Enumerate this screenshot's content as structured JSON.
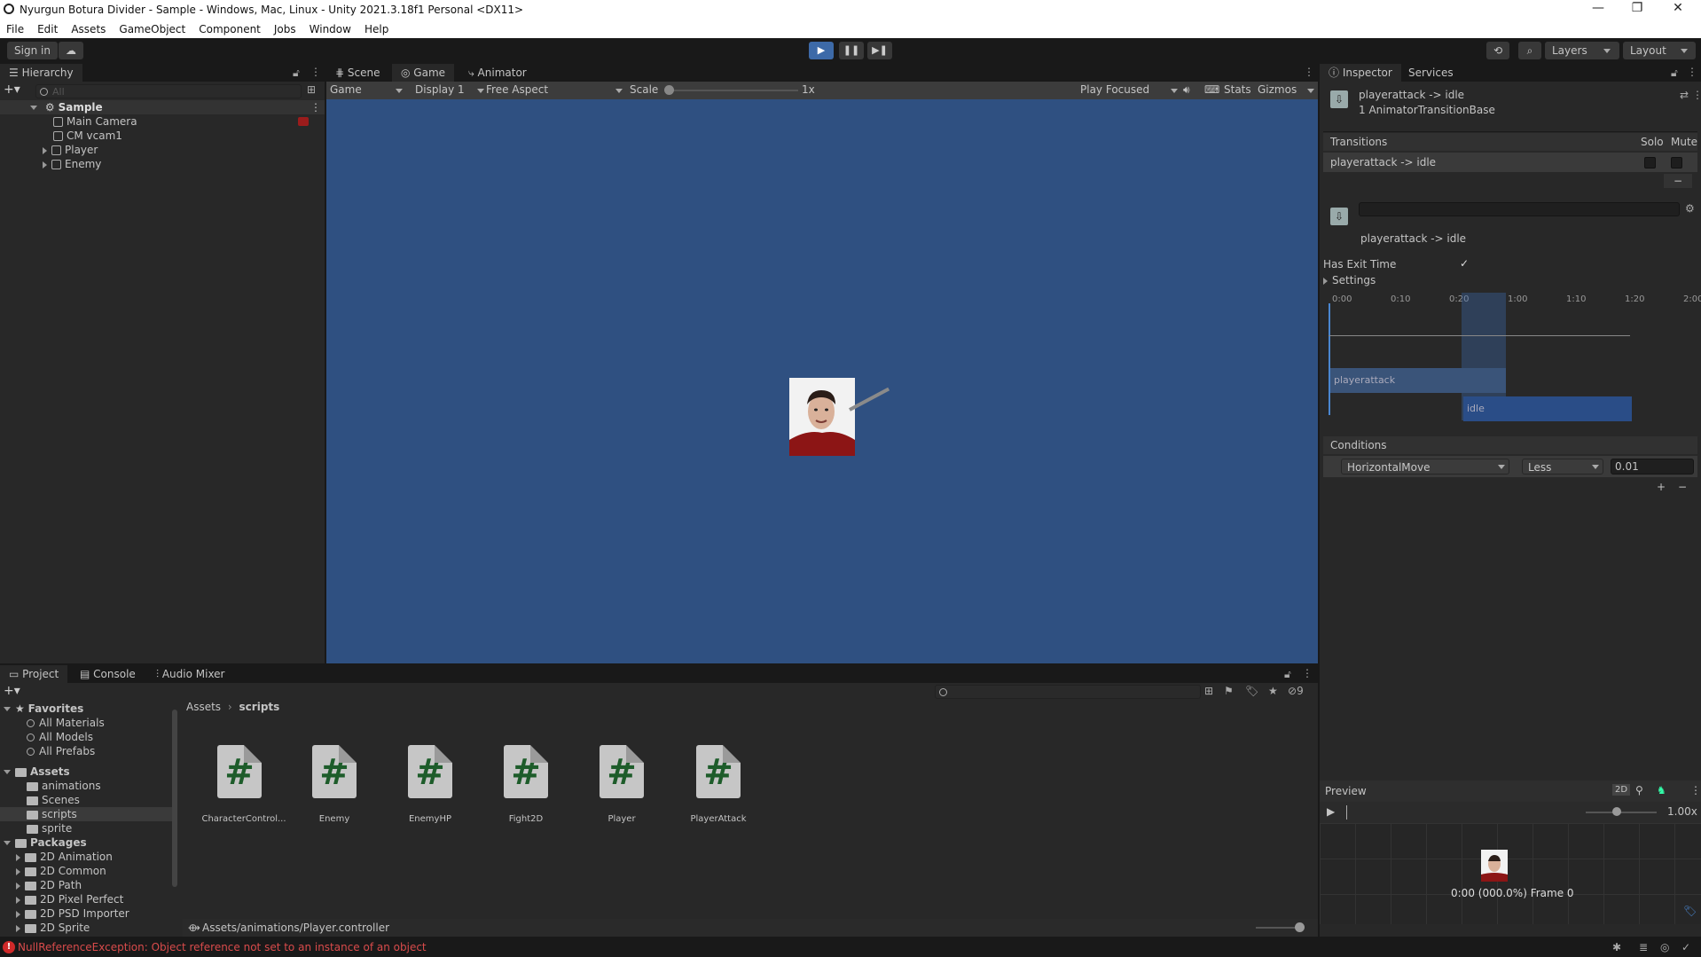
{
  "window": {
    "title": "Nyurgun Botura Divider - Sample - Windows, Mac, Linux - Unity 2021.3.18f1 Personal <DX11>",
    "controls": [
      "—",
      "❐",
      "✕"
    ]
  },
  "menu": [
    "File",
    "Edit",
    "Assets",
    "GameObject",
    "Component",
    "Jobs",
    "Window",
    "Help"
  ],
  "toolbar": {
    "sign_in": "Sign in",
    "layers": "Layers",
    "layout": "Layout"
  },
  "hierarchy": {
    "tab": "Hierarchy",
    "search_placeholder": "All",
    "scene": "Sample",
    "items": [
      "Main Camera",
      "CM vcam1",
      "Player",
      "Enemy"
    ]
  },
  "view_tabs": [
    "Scene",
    "Game",
    "Animator"
  ],
  "game_bar": {
    "mode": "Game",
    "display": "Display 1",
    "aspect": "Free Aspect",
    "scale_label": "Scale",
    "scale_value": "1x",
    "play_mode": "Play Focused",
    "stats": "Stats",
    "gizmos": "Gizmos",
    "background": "#2f5081"
  },
  "inspector": {
    "tabs": [
      "Inspector",
      "Services"
    ],
    "header_title": "playerattack -> idle",
    "header_subtitle": "1 AnimatorTransitionBase",
    "transitions_label": "Transitions",
    "solo": "Solo",
    "mute": "Mute",
    "transition_item": "playerattack -> idle",
    "minus": "−",
    "plus": "+",
    "transition_name": "playerattack -> idle",
    "has_exit_time": "Has Exit Time",
    "settings": "Settings",
    "timeline_ticks": [
      "0:00",
      "0:10",
      "0:20",
      "1:00",
      "1:10",
      "1:20",
      "2:00"
    ],
    "clip_from": "playerattack",
    "clip_to": "idle",
    "conditions_label": "Conditions",
    "condition_param": "HorizontalMove",
    "condition_op": "Less",
    "condition_value": "0.01",
    "preview_label": "Preview",
    "preview_2d": "2D",
    "preview_speed": "1.00x",
    "preview_time": "0:00 (000.0%) Frame 0"
  },
  "project": {
    "tabs": [
      "Project",
      "Console",
      "Audio Mixer"
    ],
    "hidden_count": "9",
    "favorites": "Favorites",
    "fav_items": [
      "All Materials",
      "All Models",
      "All Prefabs"
    ],
    "assets": "Assets",
    "asset_folders": [
      "animations",
      "Scenes",
      "scripts",
      "sprite"
    ],
    "packages": "Packages",
    "package_folders": [
      "2D Animation",
      "2D Common",
      "2D Path",
      "2D Pixel Perfect",
      "2D PSD Importer",
      "2D Sprite"
    ],
    "breadcrumb_root": "Assets",
    "breadcrumb_current": "scripts",
    "scripts": [
      "CharacterControl...",
      "Enemy",
      "EnemyHP",
      "Fight2D",
      "Player",
      "PlayerAttack"
    ],
    "selected_path": "Assets/animations/Player.controller"
  },
  "status": {
    "error": "NullReferenceException: Object reference not set to an instance of an object"
  }
}
